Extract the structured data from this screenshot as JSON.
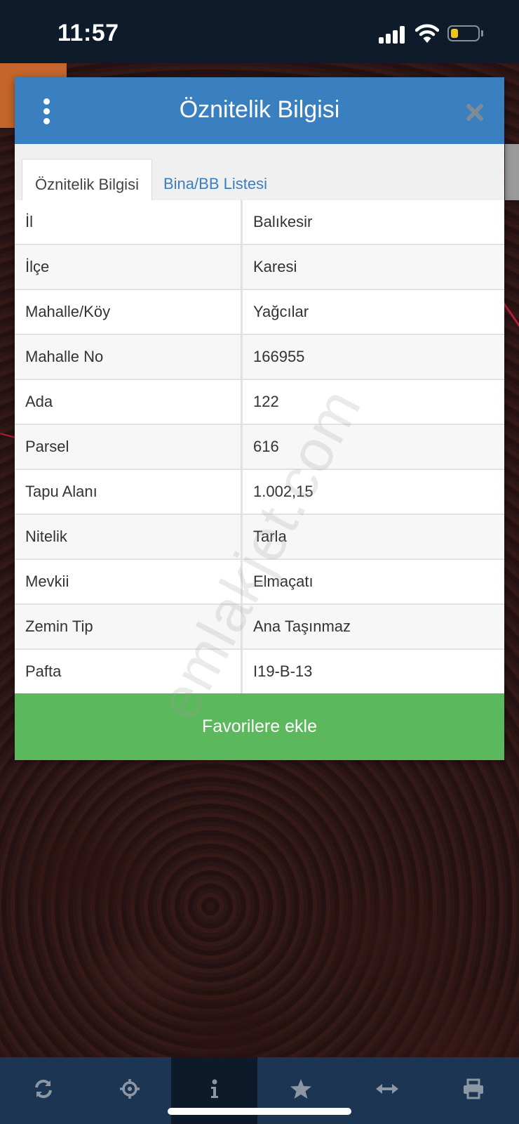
{
  "status_bar": {
    "time": "11:57",
    "battery_level": 0.25,
    "battery_color": "#f0c419"
  },
  "dialog": {
    "title": "Öznitelik Bilgisi",
    "menu_icon": "kebab-menu-icon",
    "close_icon": "close-icon",
    "header_color": "#3a7fc0"
  },
  "tabs": [
    {
      "label": "Öznitelik Bilgisi",
      "active": true
    },
    {
      "label": "Bina/BB Listesi",
      "active": false
    }
  ],
  "attributes": [
    {
      "key": "İl",
      "value": "Balıkesir"
    },
    {
      "key": "İlçe",
      "value": "Karesi"
    },
    {
      "key": "Mahalle/Köy",
      "value": "Yağcılar"
    },
    {
      "key": "Mahalle No",
      "value": "166955"
    },
    {
      "key": "Ada",
      "value": "122"
    },
    {
      "key": "Parsel",
      "value": "616"
    },
    {
      "key": "Tapu Alanı",
      "value": "1.002,15"
    },
    {
      "key": "Nitelik",
      "value": "Tarla"
    },
    {
      "key": "Mevkii",
      "value": "Elmaçatı"
    },
    {
      "key": "Zemin Tip",
      "value": "Ana Taşınmaz"
    },
    {
      "key": "Pafta",
      "value": "I19-B-13"
    }
  ],
  "favorite_button": {
    "label": "Favorilere ekle",
    "color": "#5cb85c"
  },
  "watermark": "emlakjet.com",
  "bottom_nav": [
    {
      "icon": "refresh-icon",
      "active": false
    },
    {
      "icon": "crosshair-icon",
      "active": false
    },
    {
      "icon": "info-icon",
      "active": true
    },
    {
      "icon": "star-icon",
      "active": false
    },
    {
      "icon": "measure-arrows-icon",
      "active": false
    },
    {
      "icon": "print-icon",
      "active": false
    }
  ]
}
